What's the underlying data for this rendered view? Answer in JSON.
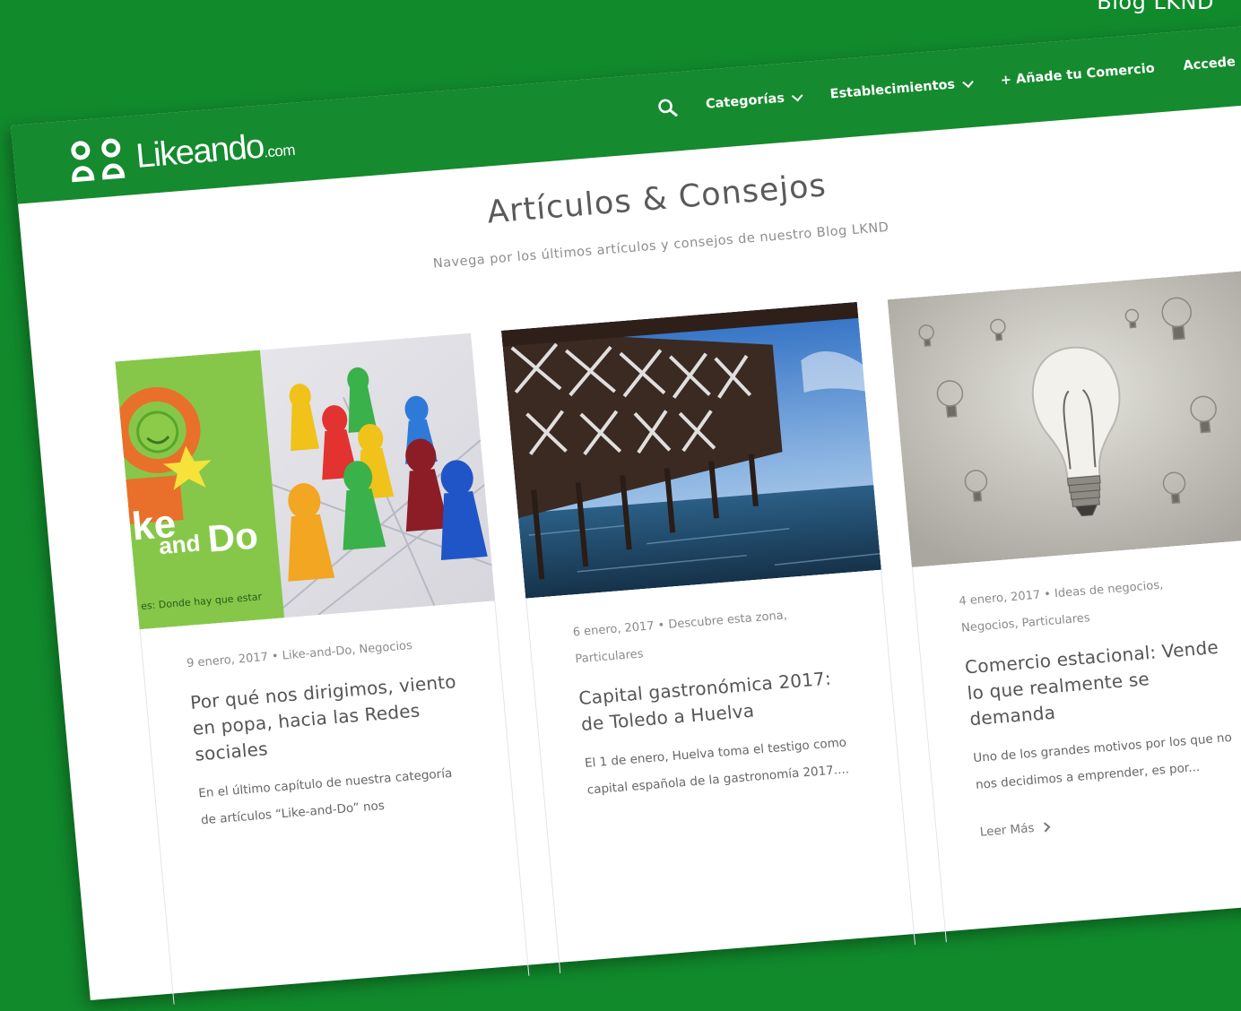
{
  "caption": "Blog LKND",
  "header": {
    "logo_text": "Likeando",
    "logo_suffix": ".com",
    "nav": {
      "categorias": "Categorías",
      "establecimientos": "Establecimientos",
      "anade": "+ Añade tu Comercio",
      "accede": "Accede"
    }
  },
  "hero": {
    "title": "Artículos & Consejos",
    "subtitle": "Navega por los últimos artículos y consejos de nuestro Blog LKND"
  },
  "cards": [
    {
      "meta_line1": "9 enero, 2017 • Like-and-Do, Negocios",
      "meta_line2": "",
      "title": "Por qué nos dirigimos, viento en popa, hacia las Redes sociales",
      "excerpt": "En el último capítulo de nuestra categoría de artículos “Like-and-Do” nos",
      "read_more": "",
      "image_text": {
        "line1": "ke",
        "line2": "and",
        "line3": "Do",
        "tagline": "es: Donde hay que estar"
      }
    },
    {
      "meta_line1": "6 enero, 2017 • Descubre esta zona,",
      "meta_line2": "Particulares",
      "title": "Capital gastronómica 2017: de Toledo a Huelva",
      "excerpt": "El 1 de enero, Huelva toma el testigo como capital española de la gastronomía 2017....",
      "read_more": ""
    },
    {
      "meta_line1": "4 enero, 2017 • Ideas de negocios,",
      "meta_line2": "Negocios, Particulares",
      "title": "Comercio estacional: Vende lo que realmente se demanda",
      "excerpt": "Uno de los grandes motivos por los que no nos decidimos a emprender, es por...",
      "read_more": "Leer Más"
    }
  ],
  "colors": {
    "brand_green": "#158a2e",
    "background_green": "#118a2c"
  }
}
